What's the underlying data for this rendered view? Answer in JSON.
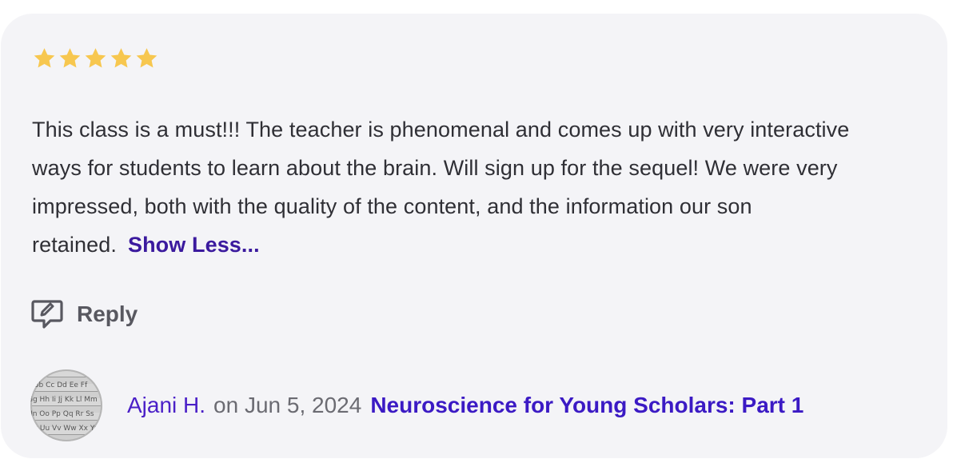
{
  "review": {
    "rating": 5,
    "rating_max": 5,
    "star_color": "#f7c74f",
    "text": "This class is a must!!! The teacher is phenomenal and comes up with very interactive ways for students to learn about the brain.  Will sign up for the sequel! We were very impressed, both with the quality of the content, and the information our son retained.",
    "show_less_label": "Show Less...",
    "reply_label": "Reply",
    "author": "Ajani H.",
    "date_text": "on Jun 5, 2024",
    "course": "Neuroscience for Young Scholars: Part 1",
    "avatar_lettering": "Aa Bb Cc Dd Ee Ff Gg Hh Ii Jj Kk Ll Mm Nn Oo Pp Qq Rr Ss Tt Uu Vv Ww Xx Yy"
  },
  "colors": {
    "card_bg": "#f4f4f7",
    "link": "#4a1fc7",
    "accent": "#3b1a9e"
  },
  "icons": {
    "star": "star-icon",
    "reply": "speech-bubble-edit-icon"
  }
}
